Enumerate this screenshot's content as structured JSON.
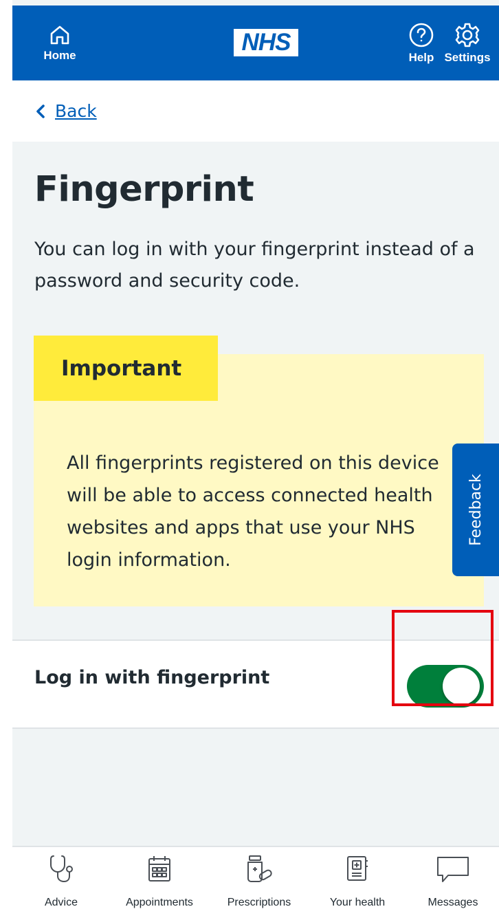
{
  "header": {
    "home_label": "Home",
    "logo_text": "NHS",
    "help_label": "Help",
    "settings_label": "Settings"
  },
  "navigation": {
    "back_label": "Back"
  },
  "page": {
    "title": "Fingerprint",
    "intro": "You can log in with your fingerprint instead of a password and security code."
  },
  "callout": {
    "label": "Important",
    "text": "All fingerprints registered on this device will be able to access connected health websites and apps that use your NHS login information."
  },
  "feedback_label": "Feedback",
  "setting": {
    "label": "Log in with fingerprint",
    "enabled": true
  },
  "bottom_nav": {
    "items": [
      {
        "label": "Advice",
        "icon": "stethoscope-icon"
      },
      {
        "label": "Appointments",
        "icon": "calendar-icon"
      },
      {
        "label": "Prescriptions",
        "icon": "pills-icon"
      },
      {
        "label": "Your health",
        "icon": "health-record-icon"
      },
      {
        "label": "Messages",
        "icon": "message-icon"
      }
    ]
  },
  "colors": {
    "nhs_blue": "#005eb8",
    "toggle_on": "#007f3b",
    "callout_label": "#ffeb3b",
    "callout_background": "#fff9c4",
    "highlight_border": "#e4000f"
  }
}
